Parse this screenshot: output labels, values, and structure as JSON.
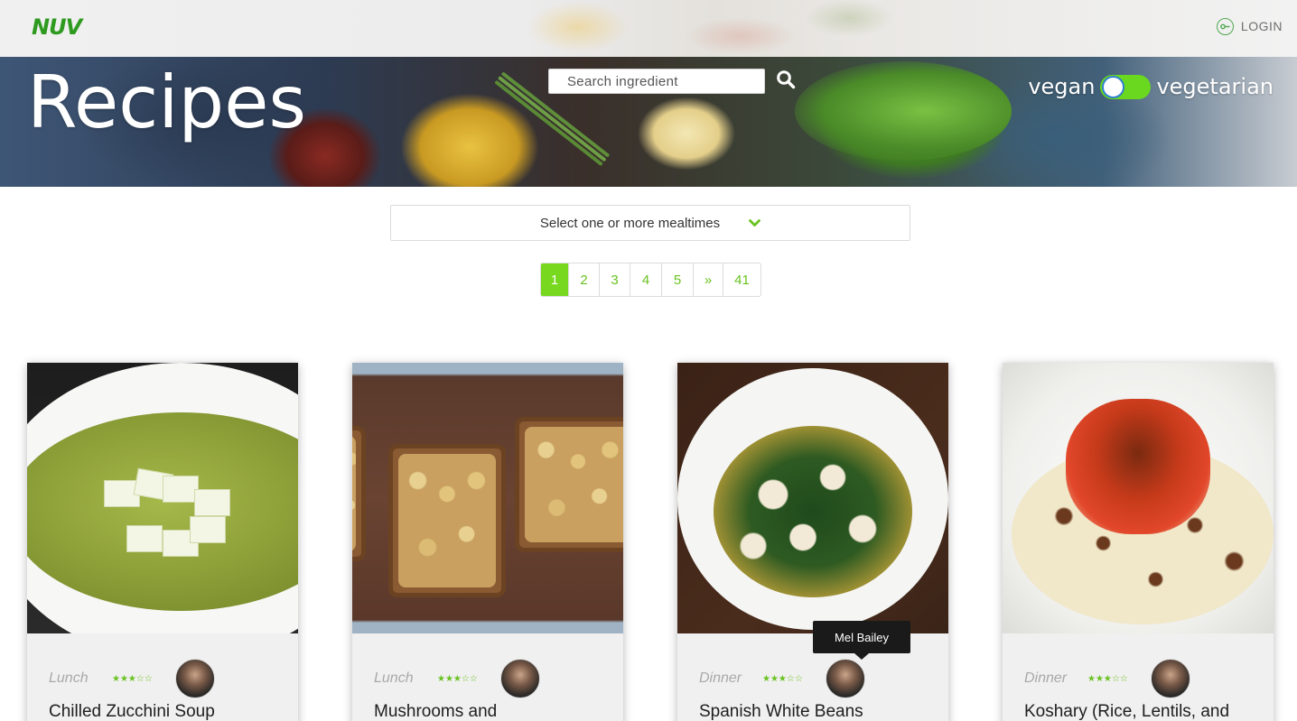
{
  "header": {
    "logo_text": "NUV",
    "login_label": "LOGIN",
    "brand_color": "#77d81f"
  },
  "hero": {
    "title": "Recipes",
    "search": {
      "placeholder": "Search ingredient",
      "value": ""
    },
    "diet_toggle": {
      "left_label": "vegan",
      "right_label": "vegetarian"
    }
  },
  "filter": {
    "mealtime_placeholder": "Select one or more mealtimes"
  },
  "pagination": {
    "pages": [
      "1",
      "2",
      "3",
      "4",
      "5",
      "»",
      "41"
    ],
    "active": "1"
  },
  "cards": [
    {
      "mealtime": "Lunch",
      "stars": "★★★☆☆",
      "title": "Chilled Zucchini Soup"
    },
    {
      "mealtime": "Lunch",
      "stars": "★★★☆☆",
      "title": "Mushrooms and"
    },
    {
      "mealtime": "Dinner",
      "stars": "★★★☆☆",
      "title": "Spanish White Beans",
      "tooltip": "Mel Bailey"
    },
    {
      "mealtime": "Dinner",
      "stars": "★★★☆☆",
      "title": "Koshary (Rice, Lentils, and"
    }
  ]
}
